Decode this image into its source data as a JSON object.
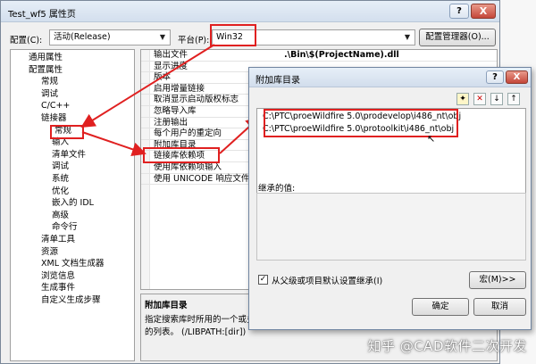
{
  "window": {
    "title": "Test_wf5 属性页",
    "help": "?",
    "close": "X"
  },
  "config": {
    "label": "配置(C):",
    "value": "活动(Release)",
    "platform_label": "平台(P):",
    "platform_value": "Win32",
    "manager_button": "配置管理器(O)..."
  },
  "tree": {
    "items": [
      {
        "label": "通用属性",
        "indent": 1
      },
      {
        "label": "配置属性",
        "indent": 1
      },
      {
        "label": "常规",
        "indent": 2
      },
      {
        "label": "调试",
        "indent": 2
      },
      {
        "label": "C/C++",
        "indent": 2
      },
      {
        "label": "链接器",
        "indent": 2
      },
      {
        "label": "常规",
        "indent": 3,
        "selected": true
      },
      {
        "label": "输入",
        "indent": 3
      },
      {
        "label": "清单文件",
        "indent": 3
      },
      {
        "label": "调试",
        "indent": 3
      },
      {
        "label": "系统",
        "indent": 3
      },
      {
        "label": "优化",
        "indent": 3
      },
      {
        "label": "嵌入的 IDL",
        "indent": 3
      },
      {
        "label": "高级",
        "indent": 3
      },
      {
        "label": "命令行",
        "indent": 3
      },
      {
        "label": "清单工具",
        "indent": 2
      },
      {
        "label": "资源",
        "indent": 2
      },
      {
        "label": "XML 文档生成器",
        "indent": 2
      },
      {
        "label": "浏览信息",
        "indent": 2
      },
      {
        "label": "生成事件",
        "indent": 2
      },
      {
        "label": "自定义生成步骤",
        "indent": 2
      }
    ]
  },
  "grid": {
    "rows": [
      {
        "key": "输出文件",
        "value": ".\\Bin\\$(ProjectName).dll"
      },
      {
        "key": "显示进度",
        "value": ""
      },
      {
        "key": "版本",
        "value": ""
      },
      {
        "key": "启用增量链接",
        "value": ""
      },
      {
        "key": "取消显示启动版权标志",
        "value": ""
      },
      {
        "key": "忽略导入库",
        "value": ""
      },
      {
        "key": "注册输出",
        "value": ""
      },
      {
        "key": "每个用户的重定向",
        "value": ""
      },
      {
        "key": "附加库目录",
        "value": ""
      },
      {
        "key": "链接库依赖项",
        "value": ""
      },
      {
        "key": "使用库依赖项输入",
        "value": ""
      },
      {
        "key": "使用 UNICODE 响应文件",
        "value": ""
      }
    ]
  },
  "description": {
    "title": "附加库目录",
    "line1": "指定搜索库时所用的一个或多个",
    "line2": "的列表。     (/LIBPATH:[dir])"
  },
  "dialog": {
    "title": "附加库目录",
    "help": "?",
    "close": "X",
    "toolbar": {
      "new_folder": "✦",
      "delete": "✕",
      "down": "↓",
      "up": "↑"
    },
    "entries": [
      "C:\\PTC\\proeWildfire 5.0\\prodevelop\\i486_nt\\obj",
      "C:\\PTC\\proeWildfire 5.0\\protoolkit\\i486_nt\\obj"
    ],
    "inherited_label": "继承的值:",
    "inherit_checkbox": "从父级或项目默认设置继承(I)",
    "macro_button": "宏(M)>>",
    "ok_button": "确定",
    "cancel_button": "取消"
  },
  "watermark": "知乎 @CAD软件二次开发",
  "colors": {
    "annotation": "#e02020"
  }
}
